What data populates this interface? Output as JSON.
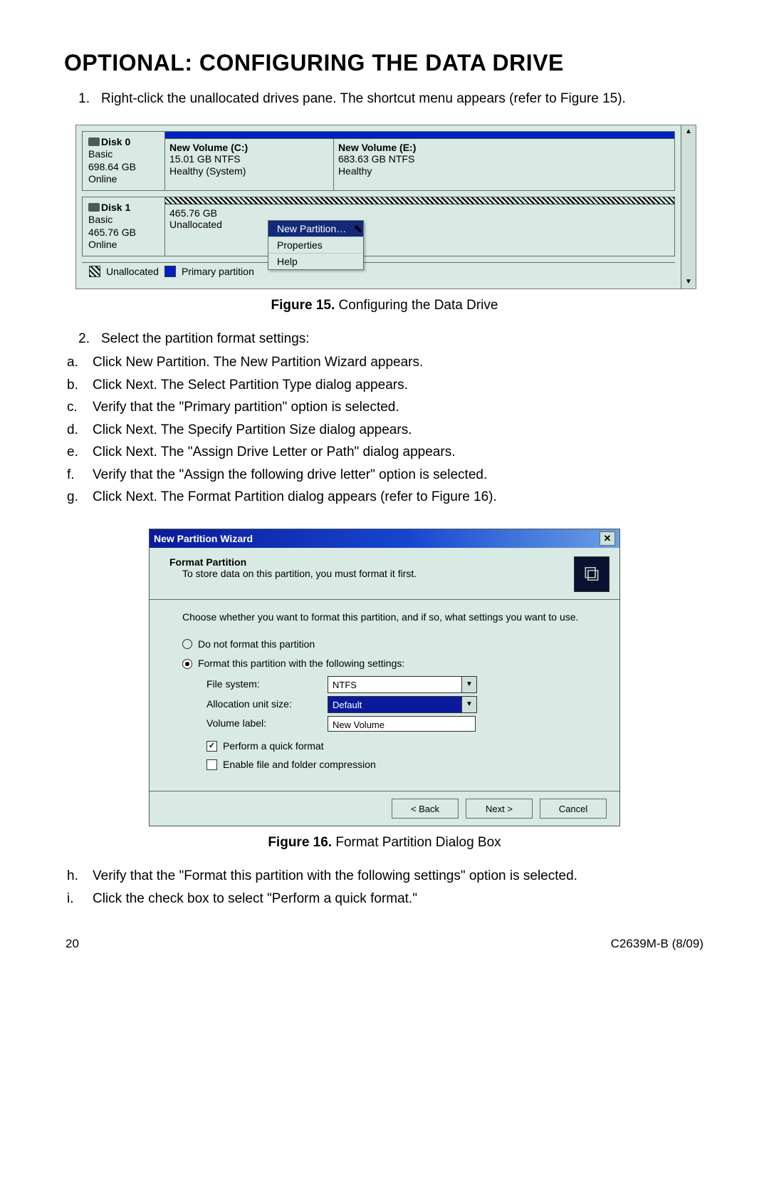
{
  "heading": "Optional: Configuring the Data Drive",
  "step1": "Right-click the unallocated drives pane. The shortcut menu appears (refer to Figure 15).",
  "fig15": {
    "disk0": {
      "name": "Disk 0",
      "type": "Basic",
      "size": "698.64 GB",
      "status": "Online",
      "vols": [
        {
          "name": "New Volume  (C:)",
          "size": "15.01 GB NTFS",
          "status": "Healthy (System)",
          "width": "33%"
        },
        {
          "name": "New Volume  (E:)",
          "size": "683.63 GB NTFS",
          "status": "Healthy",
          "width": "67%"
        }
      ]
    },
    "disk1": {
      "name": "Disk 1",
      "type": "Basic",
      "size": "465.76 GB",
      "status": "Online",
      "unalloc": {
        "size": "465.76 GB",
        "label": "Unallocated"
      }
    },
    "menu": {
      "item1": "New Partition…",
      "item2": "Properties",
      "item3": "Help"
    },
    "legend": {
      "unalloc": "Unallocated",
      "primary": "Primary partition"
    }
  },
  "cap15": {
    "bold": "Figure 15.",
    "rest": "  Configuring the Data Drive"
  },
  "step2": "Select the partition format settings:",
  "sub1": [
    {
      "n": "a.",
      "t": "Click New Partition. The New Partition Wizard appears."
    },
    {
      "n": "b.",
      "t": "Click Next. The Select Partition Type dialog appears."
    },
    {
      "n": "c.",
      "t": "Verify that the \"Primary partition\" option is selected."
    },
    {
      "n": "d.",
      "t": "Click Next. The Specify Partition Size dialog appears."
    },
    {
      "n": "e.",
      "t": "Click Next. The \"Assign Drive Letter or Path\" dialog appears."
    },
    {
      "n": "f.",
      "t": "Verify that the \"Assign the following drive letter\" option is selected."
    },
    {
      "n": "g.",
      "t": "Click Next. The Format Partition dialog appears (refer to Figure 16)."
    }
  ],
  "fig16": {
    "title": "New Partition Wizard",
    "head": "Format Partition",
    "sub": "To store data on this partition, you must format it first.",
    "intro": "Choose whether you want to format this partition, and if so, what settings you want to use.",
    "r1": "Do not format this partition",
    "r2": "Format this partition with the following settings:",
    "fs_l": "File system:",
    "fs_v": "NTFS",
    "au_l": "Allocation unit size:",
    "au_v": "Default",
    "vl_l": "Volume label:",
    "vl_v": "New Volume",
    "c1": "Perform a quick format",
    "c2": "Enable file and folder compression",
    "back": "< Back",
    "next": "Next >",
    "cancel": "Cancel"
  },
  "cap16": {
    "bold": "Figure 16.",
    "rest": "  Format Partition Dialog Box"
  },
  "sub2": [
    {
      "n": "h.",
      "t": "Verify that the \"Format this partition with the following settings\" option is selected."
    },
    {
      "n": "i.",
      "t": "Click the check box to select \"Perform a quick format.\""
    }
  ],
  "footer": {
    "page": "20",
    "doc": "C2639M-B (8/09)"
  }
}
